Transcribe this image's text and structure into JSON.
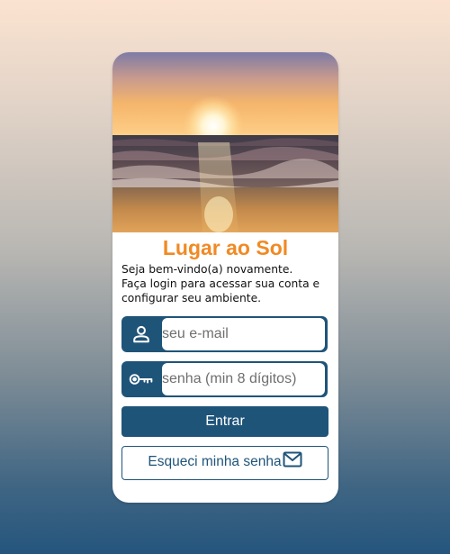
{
  "app": {
    "title": "Lugar ao Sol",
    "welcome_lines": [
      "Seja bem-vindo(a) novamente.",
      "Faça login para acessar sua conta e",
      "configurar seu ambiente."
    ]
  },
  "colors": {
    "accent": "#f08a24",
    "primary": "#1f5479"
  },
  "form": {
    "email": {
      "placeholder": "seu e-mail",
      "value": "",
      "icon": "user-icon"
    },
    "password": {
      "placeholder": "senha (min 8 dígitos)",
      "value": "",
      "icon": "key-icon"
    },
    "submit_label": "Entrar",
    "forgot_label": "Esqueci minha senha",
    "forgot_icon": "mail-icon"
  },
  "hero": {
    "description_icon": "sunset-beach-image"
  }
}
